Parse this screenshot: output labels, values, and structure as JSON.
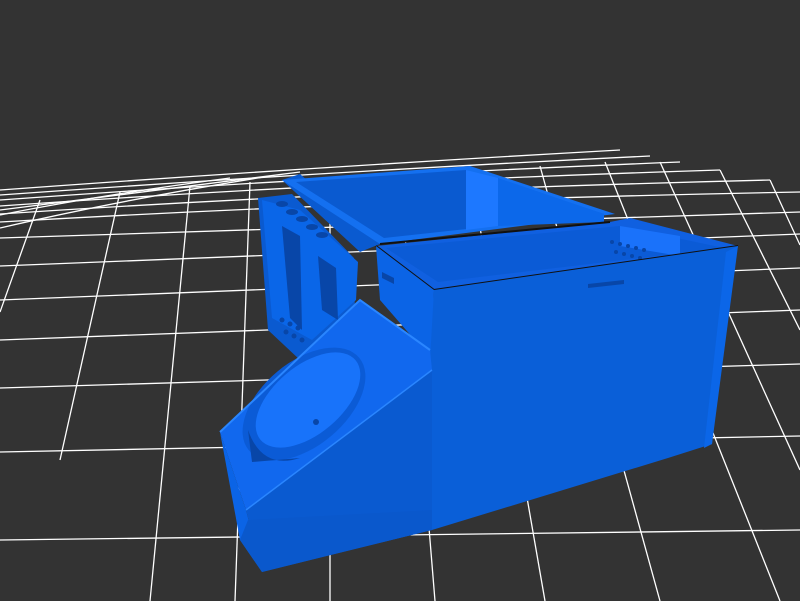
{
  "viewport": {
    "background_color": "#333333",
    "grid_color": "#ffffff",
    "model_color": "#0a5fd8",
    "model_shadow_color": "#0846a8",
    "model_highlight_color": "#1d78ff"
  }
}
